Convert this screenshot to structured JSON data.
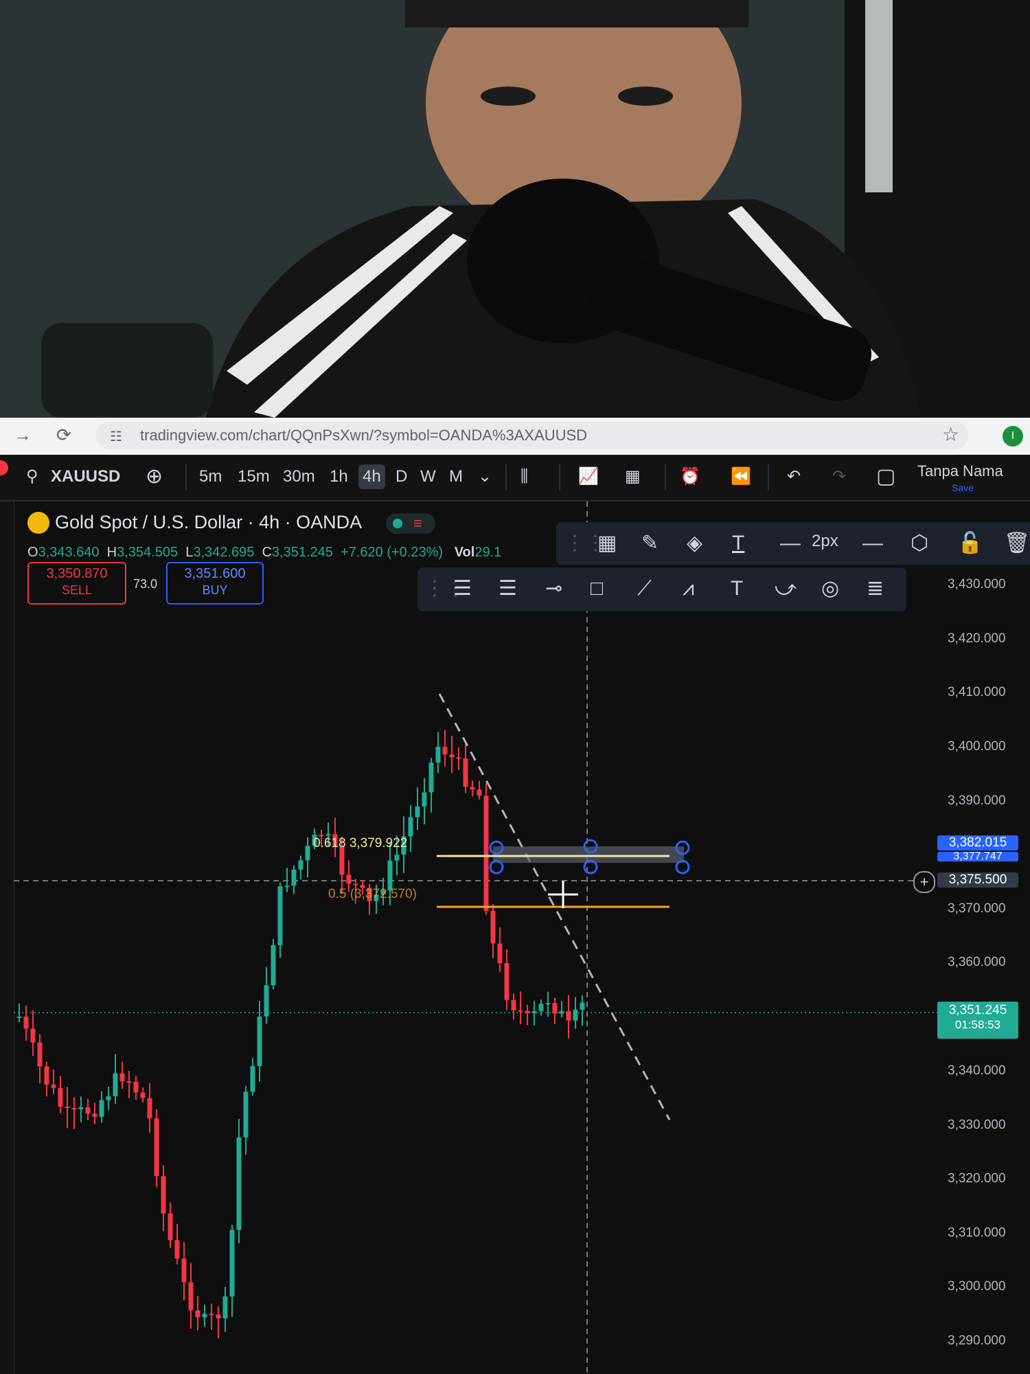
{
  "browser": {
    "url": "tradingview.com/chart/QQnPsXwn/?symbol=OANDA%3AXAUUSD",
    "profile_initial": "I"
  },
  "toolbar": {
    "symbol": "XAUUSD",
    "timeframes": [
      "5m",
      "15m",
      "30m",
      "1h",
      "4h",
      "D",
      "W",
      "M"
    ],
    "selected_timeframe": "4h",
    "layout_name": "Tanpa Nama",
    "save_label": "Save"
  },
  "legend": {
    "title": "Gold Spot / U.S. Dollar · 4h · OANDA",
    "open_label": "O",
    "open": "3,343.640",
    "high_label": "H",
    "high": "3,354.505",
    "low_label": "L",
    "low": "3,342.695",
    "close_label": "C",
    "close": "3,351.245",
    "change": "+7.620 (+0.23%)",
    "vol_label": "Vol",
    "vol": "29.1"
  },
  "trade": {
    "sell_price": "3,350.870",
    "sell_label": "SELL",
    "spread": "73.0",
    "buy_price": "3,351.600",
    "buy_label": "BUY"
  },
  "draw_props": {
    "stroke": "2px"
  },
  "price_axis": {
    "labels": [
      "3,430.000",
      "3,420.000",
      "3,410.000",
      "3,400.000",
      "3,390.000",
      "3,370.000",
      "3,360.000",
      "3,340.000",
      "3,330.000",
      "3,320.000",
      "3,310.000",
      "3,300.000",
      "3,290.000"
    ],
    "tag_high": "3,382.015",
    "tag_high2": "3,377.747",
    "crosshair_price": "3,375.500",
    "last_price": "3,351.245",
    "countdown": "01:58:53"
  },
  "fib": {
    "level_618": "0.618",
    "price_618": "3,379.922",
    "level_5": "0.5",
    "price_5": "3,372.570"
  },
  "colors": {
    "up": "#22ab94",
    "down": "#f23645",
    "accent": "#2962ff"
  }
}
